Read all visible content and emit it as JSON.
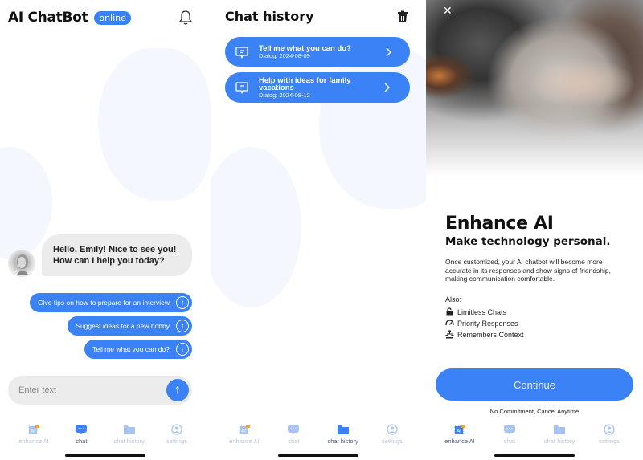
{
  "colors": {
    "accent": "#3b82f6",
    "bubble_bg": "#ececec",
    "nav_inactive": "#b5c4dc",
    "nav_active": "#3f5a80"
  },
  "chat_screen": {
    "header": {
      "title": "AI ChatBot",
      "status_badge": "online",
      "bell_icon": "bell-icon"
    },
    "bot_message": "Hello, Emily! Nice to see you! How can I help you today?",
    "suggestions": [
      {
        "label": "Give tips on how to prepare for an interview",
        "icon": "arrow-up-circle-icon"
      },
      {
        "label": "Suggest ideas for a new hobby",
        "icon": "arrow-up-circle-icon"
      },
      {
        "label": "Tell me what you can do?",
        "icon": "arrow-up-circle-icon"
      }
    ],
    "input": {
      "placeholder": "Enter text",
      "value": ""
    },
    "send_icon": "arrow-up-icon",
    "active_tab": "chat"
  },
  "history_screen": {
    "title": "Chat history",
    "trash_icon": "trash-icon",
    "items": [
      {
        "title": "Tell me what you can do?",
        "date": "Dialog: 2024-08-09"
      },
      {
        "title": "Help with ideas for family vacations",
        "date": "Dialog: 2024-08-12"
      }
    ],
    "active_tab": "chat history"
  },
  "enhance_screen": {
    "close_icon": "close-icon",
    "title": "Enhance AI",
    "subtitle": "Make technology personal.",
    "description": "Once customized, your AI chatbot will become more accurate in its responses and show signs of friendship, making communication comfortable.",
    "also_label": "Also:",
    "features": [
      {
        "label": "Limitless Chats",
        "icon": "unlock-icon"
      },
      {
        "label": "Priority Responses",
        "icon": "gauge-icon"
      },
      {
        "label": "Remembers Context",
        "icon": "network-icon"
      }
    ],
    "continue_label": "Continue",
    "footnote": "No Commitment, Cancel Anytime",
    "active_tab": "enhance AI"
  },
  "nav": {
    "items": [
      {
        "label": "enhance AI",
        "icon": "ai-chip-lock-icon"
      },
      {
        "label": "chat",
        "icon": "chat-bubble-icon"
      },
      {
        "label": "chat history",
        "icon": "folder-icon"
      },
      {
        "label": "settings",
        "icon": "user-circle-icon"
      }
    ]
  }
}
